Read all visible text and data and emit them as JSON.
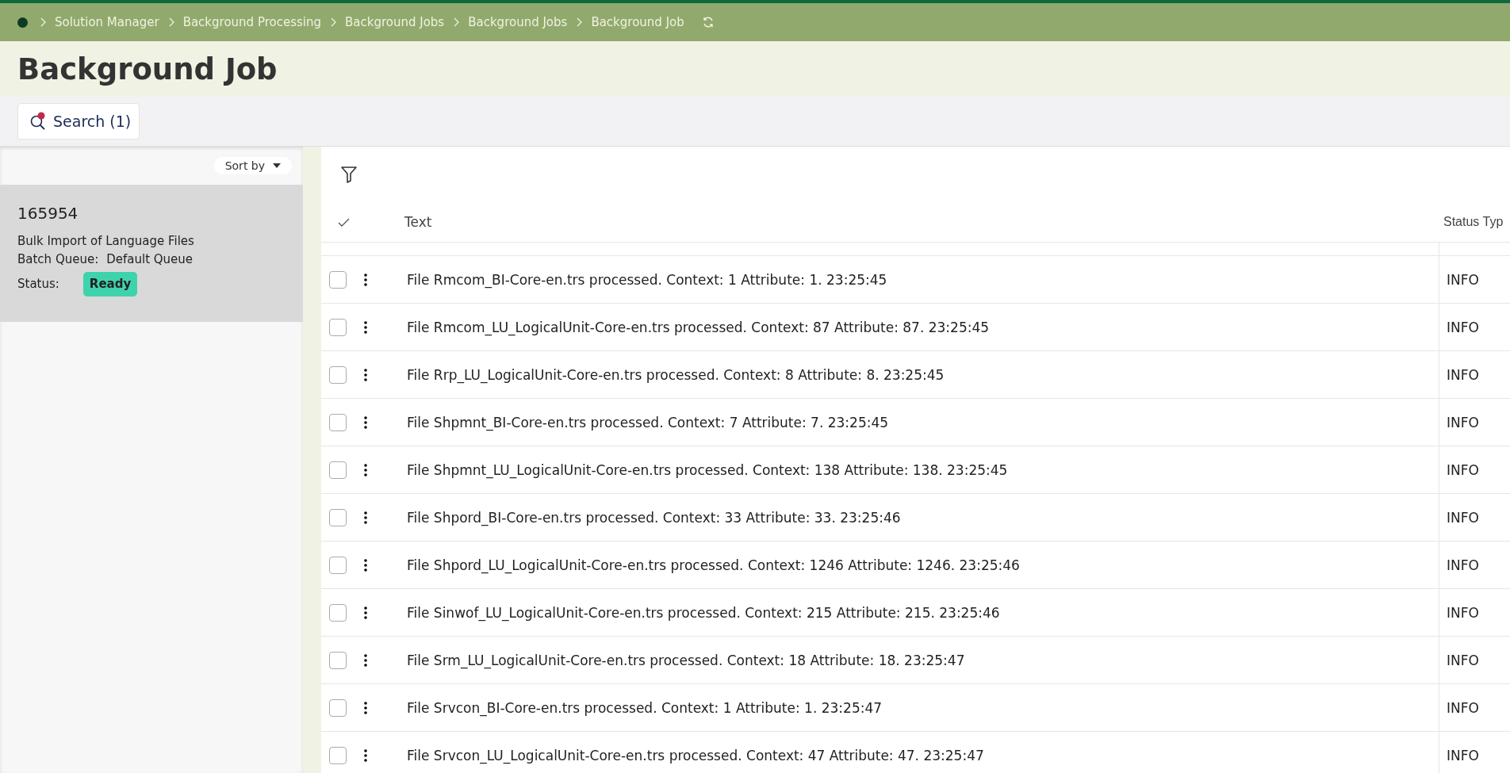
{
  "breadcrumb": [
    "Solution Manager",
    "Background Processing",
    "Background Jobs",
    "Background Jobs",
    "Background Job"
  ],
  "page_title": "Background Job",
  "search_button": "Search (1)",
  "sidebar": {
    "sort_label": "Sort by",
    "items": [
      {
        "id": "165954",
        "description": "Bulk Import of Language Files",
        "queue_label": "Batch Queue:",
        "queue": "Default Queue",
        "status_label": "Status:",
        "status": "Ready",
        "selected": true
      }
    ]
  },
  "table": {
    "columns": [
      "Text",
      "Status Typ"
    ],
    "rows": [
      {
        "text": "File Rmcom_BI-Core-en.trs processed. Context: 1 Attribute: 1. 23:25:45",
        "status_type": "INFO",
        "checked": false
      },
      {
        "text": "File Rmcom_LU_LogicalUnit-Core-en.trs processed. Context: 87 Attribute: 87. 23:25:45",
        "status_type": "INFO",
        "checked": false
      },
      {
        "text": "File Rrp_LU_LogicalUnit-Core-en.trs processed. Context: 8 Attribute: 8. 23:25:45",
        "status_type": "INFO",
        "checked": false
      },
      {
        "text": "File Shpmnt_BI-Core-en.trs processed. Context: 7 Attribute: 7. 23:25:45",
        "status_type": "INFO",
        "checked": false
      },
      {
        "text": "File Shpmnt_LU_LogicalUnit-Core-en.trs processed. Context: 138 Attribute: 138. 23:25:45",
        "status_type": "INFO",
        "checked": false
      },
      {
        "text": "File Shpord_BI-Core-en.trs processed. Context: 33 Attribute: 33. 23:25:46",
        "status_type": "INFO",
        "checked": false
      },
      {
        "text": "File Shpord_LU_LogicalUnit-Core-en.trs processed. Context: 1246 Attribute: 1246. 23:25:46",
        "status_type": "INFO",
        "checked": false
      },
      {
        "text": "File Sinwof_LU_LogicalUnit-Core-en.trs processed. Context: 215 Attribute: 215. 23:25:46",
        "status_type": "INFO",
        "checked": false
      },
      {
        "text": "File Srm_LU_LogicalUnit-Core-en.trs processed. Context: 18 Attribute: 18. 23:25:47",
        "status_type": "INFO",
        "checked": false
      },
      {
        "text": "File Srvcon_BI-Core-en.trs processed. Context: 1 Attribute: 1. 23:25:47",
        "status_type": "INFO",
        "checked": false
      },
      {
        "text": "File Srvcon_LU_LogicalUnit-Core-en.trs processed. Context: 47 Attribute: 47. 23:25:47",
        "status_type": "INFO",
        "checked": false
      }
    ]
  }
}
